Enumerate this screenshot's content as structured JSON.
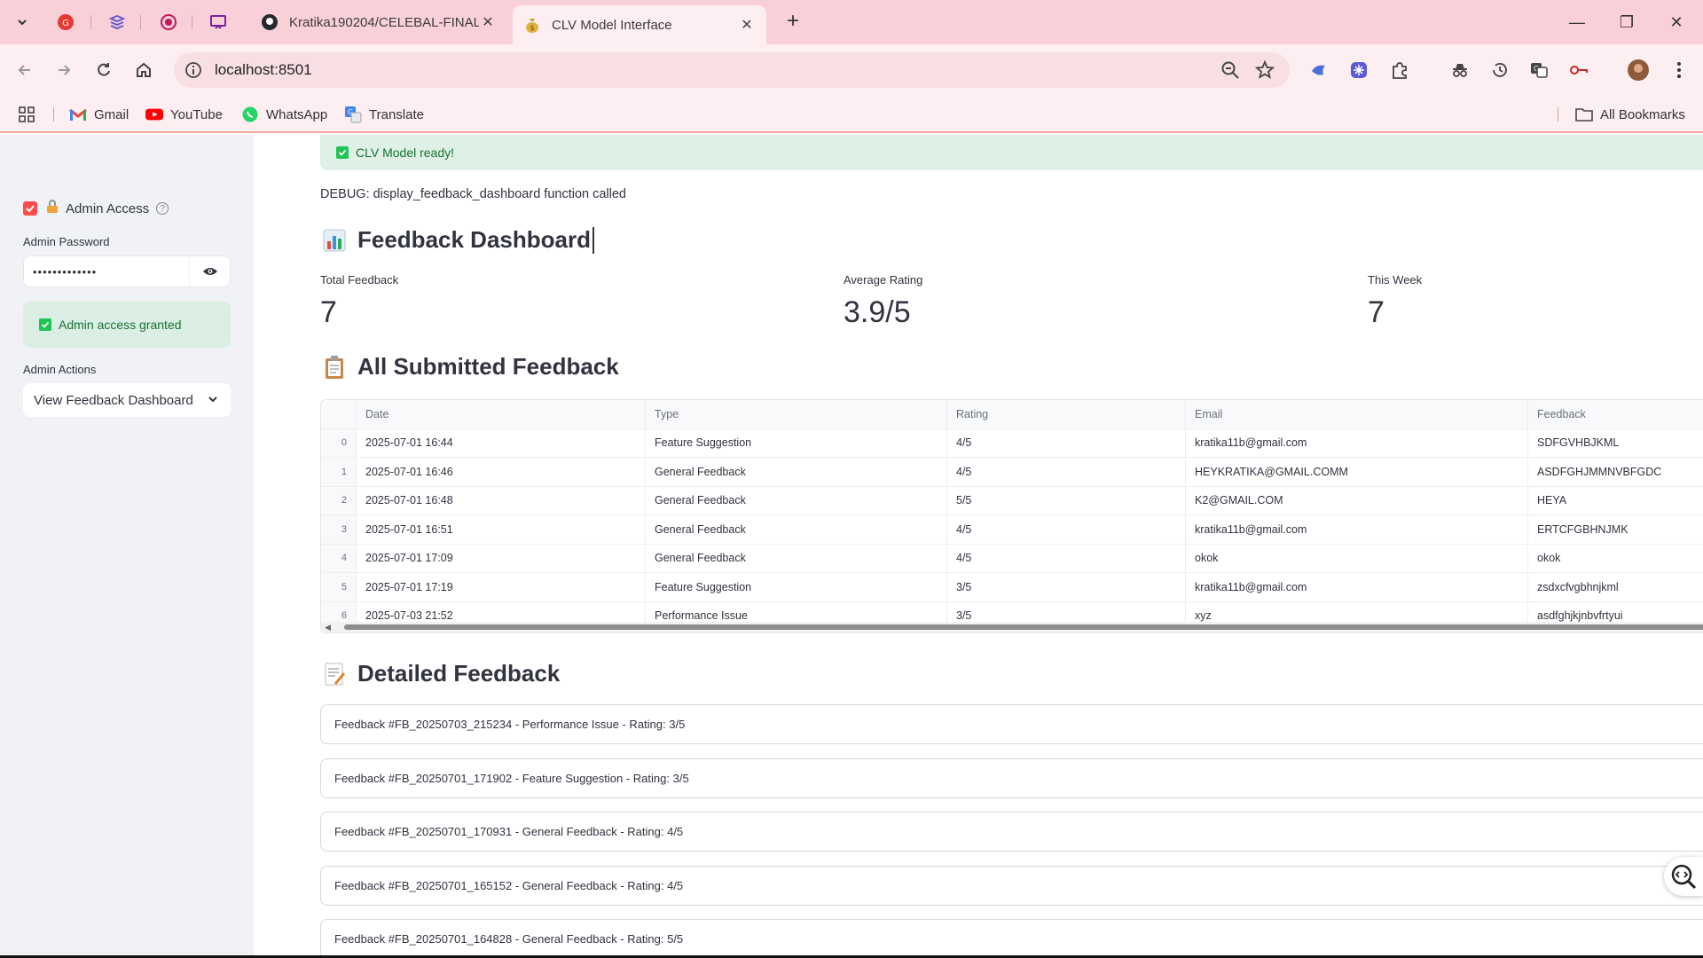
{
  "browser": {
    "tabs": [
      {
        "title": "Kratika190204/CELEBAL-FINAL-",
        "active": false
      },
      {
        "title": "CLV Model Interface",
        "active": true
      }
    ],
    "url": "localhost:8501",
    "bookmarks": [
      "Gmail",
      "YouTube",
      "WhatsApp",
      "Translate"
    ],
    "all_bookmarks": "All Bookmarks"
  },
  "sidebar": {
    "admin_access_label": "Admin Access",
    "password_label": "Admin Password",
    "password_value": "•••••••••••••",
    "success_text": "Admin access granted",
    "actions_label": "Admin Actions",
    "actions_selected": "View Feedback Dashboard"
  },
  "main": {
    "ready_text": "CLV Model ready!",
    "debug_text": "DEBUG: display_feedback_dashboard function called",
    "dashboard_title": "Feedback Dashboard",
    "metrics": [
      {
        "label": "Total Feedback",
        "value": "7"
      },
      {
        "label": "Average Rating",
        "value": "3.9/5"
      },
      {
        "label": "This Week",
        "value": "7"
      }
    ],
    "all_feedback_title": "All Submitted Feedback",
    "table": {
      "columns": [
        "Date",
        "Type",
        "Rating",
        "Email",
        "Feedback"
      ],
      "rows": [
        {
          "idx": "0",
          "cells": [
            "2025-07-01 16:44",
            "Feature Suggestion",
            "4/5",
            "kratika11b@gmail.com",
            "SDFGVHBJKML"
          ]
        },
        {
          "idx": "1",
          "cells": [
            "2025-07-01 16:46",
            "General Feedback",
            "4/5",
            "HEYKRATIKA@GMAIL.COMM",
            "ASDFGHJMMNVBFGDC"
          ]
        },
        {
          "idx": "2",
          "cells": [
            "2025-07-01 16:48",
            "General Feedback",
            "5/5",
            "K2@GMAIL.COM",
            "HEYA"
          ]
        },
        {
          "idx": "3",
          "cells": [
            "2025-07-01 16:51",
            "General Feedback",
            "4/5",
            "kratika11b@gmail.com",
            "ERTCFGBHNJMK"
          ]
        },
        {
          "idx": "4",
          "cells": [
            "2025-07-01 17:09",
            "General Feedback",
            "4/5",
            "okok",
            "okok"
          ]
        },
        {
          "idx": "5",
          "cells": [
            "2025-07-01 17:19",
            "Feature Suggestion",
            "3/5",
            "kratika11b@gmail.com",
            "zsdxcfvgbhnjkml"
          ]
        },
        {
          "idx": "6",
          "cells": [
            "2025-07-03 21:52",
            "Performance Issue",
            "3/5",
            "xyz",
            "asdfghjkjnbvfrtyui"
          ]
        }
      ]
    },
    "detailed_title": "Detailed Feedback",
    "detailed_items": [
      "Feedback #FB_20250703_215234 - Performance Issue - Rating: 3/5",
      "Feedback #FB_20250701_171902 - Feature Suggestion - Rating: 3/5",
      "Feedback #FB_20250701_170931 - General Feedback - Rating: 4/5",
      "Feedback #FB_20250701_165152 - General Feedback - Rating: 4/5",
      "Feedback #FB_20250701_164828 - General Feedback - Rating: 5/5"
    ]
  },
  "colors": {
    "accent": "#ff4b4b",
    "success_bg": "#dbeee4",
    "success_text": "#177233",
    "tabbar": "#f9d0d8"
  }
}
